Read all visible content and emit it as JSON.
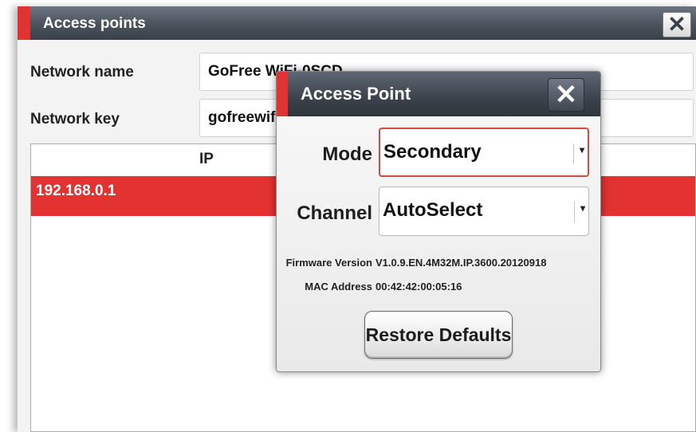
{
  "window": {
    "title": "Access points",
    "close_icon": "✕",
    "network_name_label": "Network name",
    "network_name_value": "GoFree WiFi-0SCD",
    "network_key_label": "Network key",
    "network_key_value": "gofreewifi",
    "table": {
      "columns": [
        "IP"
      ],
      "rows": [
        {
          "ip": "192.168.0.1",
          "selected": true
        }
      ]
    }
  },
  "dialog": {
    "title": "Access Point",
    "close_icon": "✕",
    "mode_label": "Mode",
    "mode_value": "Secondary",
    "channel_label": "Channel",
    "channel_value": "AutoSelect",
    "firmware_label": "Firmware Version",
    "firmware_value": "V1.0.9.EN.4M32M.IP.3600.20120918",
    "mac_label": "MAC Address",
    "mac_value": "00:42:42:00:05:16",
    "restore_label": "Restore Defaults"
  },
  "colors": {
    "accent": "#e23232",
    "titlebar": "#4a525c",
    "focus_border": "#d94a3c"
  }
}
